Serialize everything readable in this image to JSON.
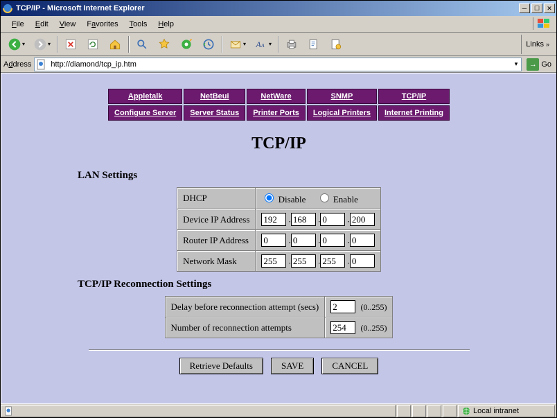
{
  "window": {
    "title": "TCP/IP - Microsoft Internet Explorer"
  },
  "menu": {
    "file": "File",
    "edit": "Edit",
    "view": "View",
    "favorites": "Favorites",
    "tools": "Tools",
    "help": "Help"
  },
  "toolbar": {
    "back": "Back",
    "forward": "Forward",
    "stop": "Stop",
    "refresh": "Refresh",
    "home": "Home",
    "search": "Search",
    "favorites": "Favorites",
    "media": "Media",
    "history": "History",
    "mail": "Mail",
    "print": "Print",
    "edit": "Edit",
    "links": "Links"
  },
  "address": {
    "label": "Address",
    "url": "http://diamond/tcp_ip.htm",
    "go": "Go"
  },
  "nav": {
    "row1": [
      "Appletalk",
      "NetBeui",
      "NetWare",
      "SNMP",
      "TCP/IP"
    ],
    "row2": [
      "Configure Server",
      "Server Status",
      "Printer Ports",
      "Logical Printers",
      "Internet Printing"
    ]
  },
  "page": {
    "heading": "TCP/IP",
    "lan_title": "LAN Settings",
    "dhcp_label": "DHCP",
    "disable": "Disable",
    "enable": "Enable",
    "device_ip_label": "Device IP Address",
    "router_ip_label": "Router IP Address",
    "netmask_label": "Network Mask",
    "device_ip": [
      "192",
      "168",
      "0",
      "200"
    ],
    "router_ip": [
      "0",
      "0",
      "0",
      "0"
    ],
    "netmask": [
      "255",
      "255",
      "255",
      "0"
    ],
    "reconn_title": "TCP/IP Reconnection Settings",
    "delay_label": "Delay before reconnection attempt (secs)",
    "attempts_label": "Number of reconnection attempts",
    "delay_value": "2",
    "attempts_value": "254",
    "range": "(0..255)",
    "retrieve": "Retrieve Defaults",
    "save": "SAVE",
    "cancel": "CANCEL"
  },
  "status": {
    "zone": "Local intranet"
  }
}
